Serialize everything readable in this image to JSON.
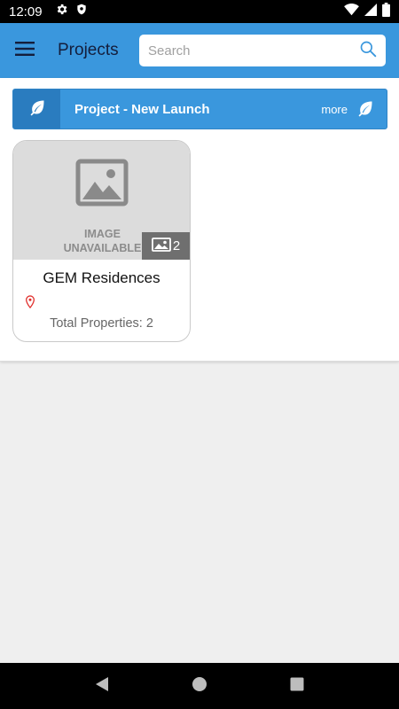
{
  "status_bar": {
    "time": "12:09",
    "icons_left": [
      "gear-icon",
      "shield-icon"
    ],
    "icons_right": [
      "wifi-icon",
      "signal-icon",
      "battery-icon"
    ]
  },
  "app_bar": {
    "title": "Projects",
    "search_placeholder": "Search",
    "search_value": "",
    "color": "#3a97dd"
  },
  "banner": {
    "title": "Project - New Launch",
    "more_label": "more",
    "icon": "leaf-icon"
  },
  "projects": [
    {
      "name": "GEM Residences",
      "image_unavailable_line1": "IMAGE",
      "image_unavailable_line2": "UNAVAILABLE",
      "photo_count": "2",
      "total_properties_label": "Total Properties: 2"
    }
  ],
  "nav_bar": {
    "buttons": [
      "back-icon",
      "home-icon",
      "recents-icon"
    ]
  }
}
